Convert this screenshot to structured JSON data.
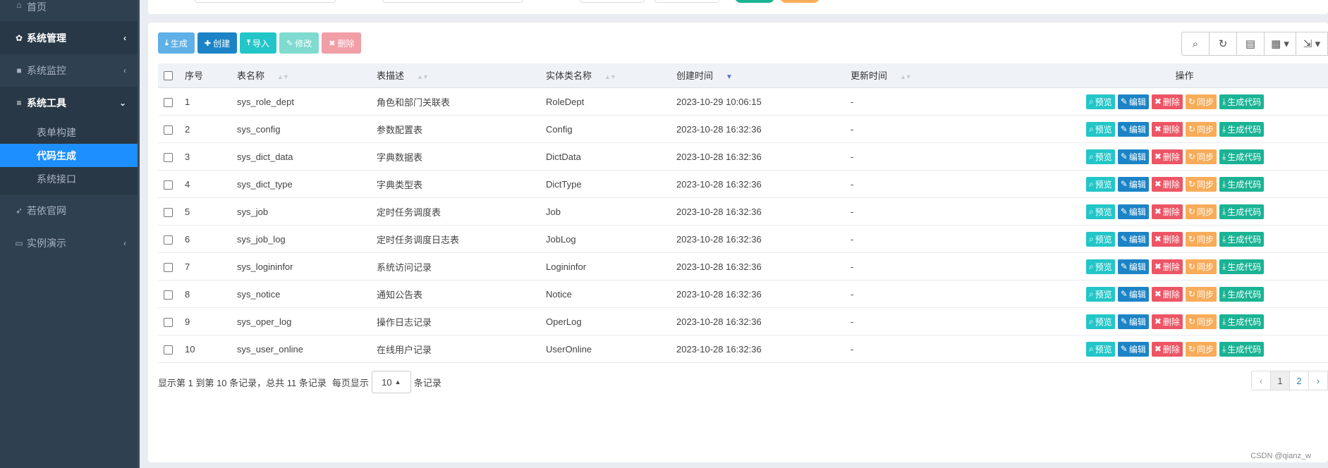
{
  "sidebar": {
    "items": [
      {
        "label": "首页",
        "icon": "home-icon",
        "glyph": "⌂"
      },
      {
        "label": "系统管理",
        "icon": "gear-icon",
        "glyph": "✿",
        "arrow": "‹"
      },
      {
        "label": "系统监控",
        "icon": "video-icon",
        "glyph": "■",
        "arrow": "‹"
      },
      {
        "label": "系统工具",
        "icon": "bars-icon",
        "glyph": "≡",
        "arrow": "⌄"
      },
      {
        "label": "若依官网",
        "icon": "send-icon",
        "glyph": "➶"
      },
      {
        "label": "实例演示",
        "icon": "desktop-icon",
        "glyph": "▭",
        "arrow": "‹"
      }
    ],
    "subitems": [
      {
        "label": "表单构建"
      },
      {
        "label": "代码生成"
      },
      {
        "label": "系统接口"
      }
    ]
  },
  "toolbar": {
    "generate_label": "生成",
    "create_label": "创建",
    "import_label": "导入",
    "edit_label": "修改",
    "delete_label": "删除"
  },
  "table": {
    "headers": {
      "no": "序号",
      "table_name": "表名称",
      "table_desc": "表描述",
      "class_name": "实体类名称",
      "create_time": "创建时间",
      "update_time": "更新时间",
      "actions": "操作"
    },
    "rows": [
      {
        "no": "1",
        "table_name": "sys_role_dept",
        "table_desc": "角色和部门关联表",
        "class_name": "RoleDept",
        "create_time": "2023-10-29 10:06:15",
        "update_time": "-"
      },
      {
        "no": "2",
        "table_name": "sys_config",
        "table_desc": "参数配置表",
        "class_name": "Config",
        "create_time": "2023-10-28 16:32:36",
        "update_time": "-"
      },
      {
        "no": "3",
        "table_name": "sys_dict_data",
        "table_desc": "字典数据表",
        "class_name": "DictData",
        "create_time": "2023-10-28 16:32:36",
        "update_time": "-"
      },
      {
        "no": "4",
        "table_name": "sys_dict_type",
        "table_desc": "字典类型表",
        "class_name": "DictType",
        "create_time": "2023-10-28 16:32:36",
        "update_time": "-"
      },
      {
        "no": "5",
        "table_name": "sys_job",
        "table_desc": "定时任务调度表",
        "class_name": "Job",
        "create_time": "2023-10-28 16:32:36",
        "update_time": "-"
      },
      {
        "no": "6",
        "table_name": "sys_job_log",
        "table_desc": "定时任务调度日志表",
        "class_name": "JobLog",
        "create_time": "2023-10-28 16:32:36",
        "update_time": "-"
      },
      {
        "no": "7",
        "table_name": "sys_logininfor",
        "table_desc": "系统访问记录",
        "class_name": "Logininfor",
        "create_time": "2023-10-28 16:32:36",
        "update_time": "-"
      },
      {
        "no": "8",
        "table_name": "sys_notice",
        "table_desc": "通知公告表",
        "class_name": "Notice",
        "create_time": "2023-10-28 16:32:36",
        "update_time": "-"
      },
      {
        "no": "9",
        "table_name": "sys_oper_log",
        "table_desc": "操作日志记录",
        "class_name": "OperLog",
        "create_time": "2023-10-28 16:32:36",
        "update_time": "-"
      },
      {
        "no": "10",
        "table_name": "sys_user_online",
        "table_desc": "在线用户记录",
        "class_name": "UserOnline",
        "create_time": "2023-10-28 16:32:36",
        "update_time": "-"
      }
    ],
    "row_actions": {
      "preview": "预览",
      "edit": "编辑",
      "delete": "删除",
      "sync": "同步",
      "generate": "生成代码"
    }
  },
  "pagination": {
    "summary": "显示第 1 到第 10 条记录，总共 11 条记录",
    "per_page_prefix": "每页显示",
    "page_size": "10",
    "per_page_suffix": "条记录",
    "prev": "‹",
    "pages": [
      "1",
      "2"
    ],
    "next": "›"
  },
  "watermark": "CSDN @qianz_w",
  "colors": {
    "sidebar_bg": "#2f4050",
    "active_item": "#1e8fff",
    "preview": "#23c6c8",
    "edit": "#1c84c6",
    "delete": "#ed5565",
    "sync": "#f8ac59",
    "generate": "#1ab394"
  }
}
